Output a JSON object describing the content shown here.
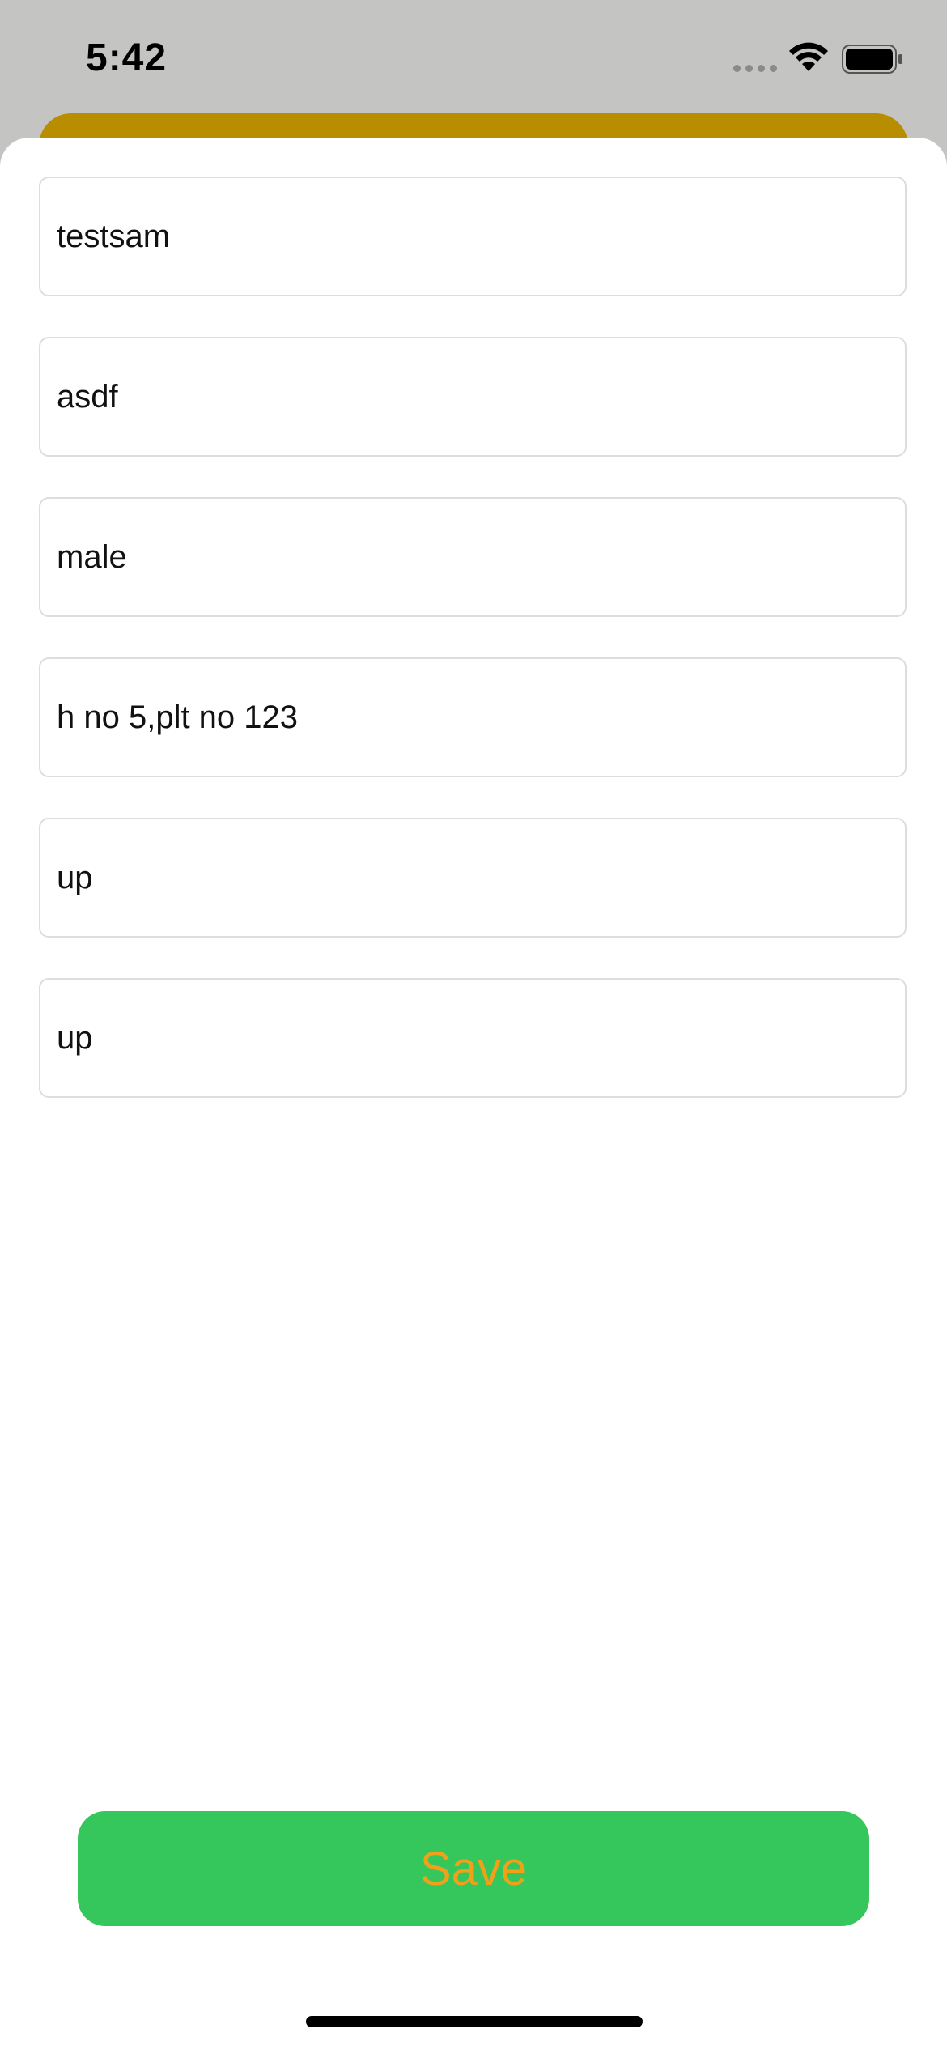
{
  "status_bar": {
    "time": "5:42",
    "wifi_icon": "wifi-icon",
    "battery_icon": "battery-icon",
    "signal_icon": "cellular-signal-icon"
  },
  "colors": {
    "header_accent": "#b88e00",
    "save_button_bg": "#35c75b",
    "save_button_text": "#f2a019"
  },
  "form": {
    "fields": [
      {
        "value": "testsam"
      },
      {
        "value": "asdf"
      },
      {
        "value": "male"
      },
      {
        "value": "h no 5,plt no 123"
      },
      {
        "value": "up"
      },
      {
        "value": "up"
      }
    ],
    "save_label": "Save"
  }
}
